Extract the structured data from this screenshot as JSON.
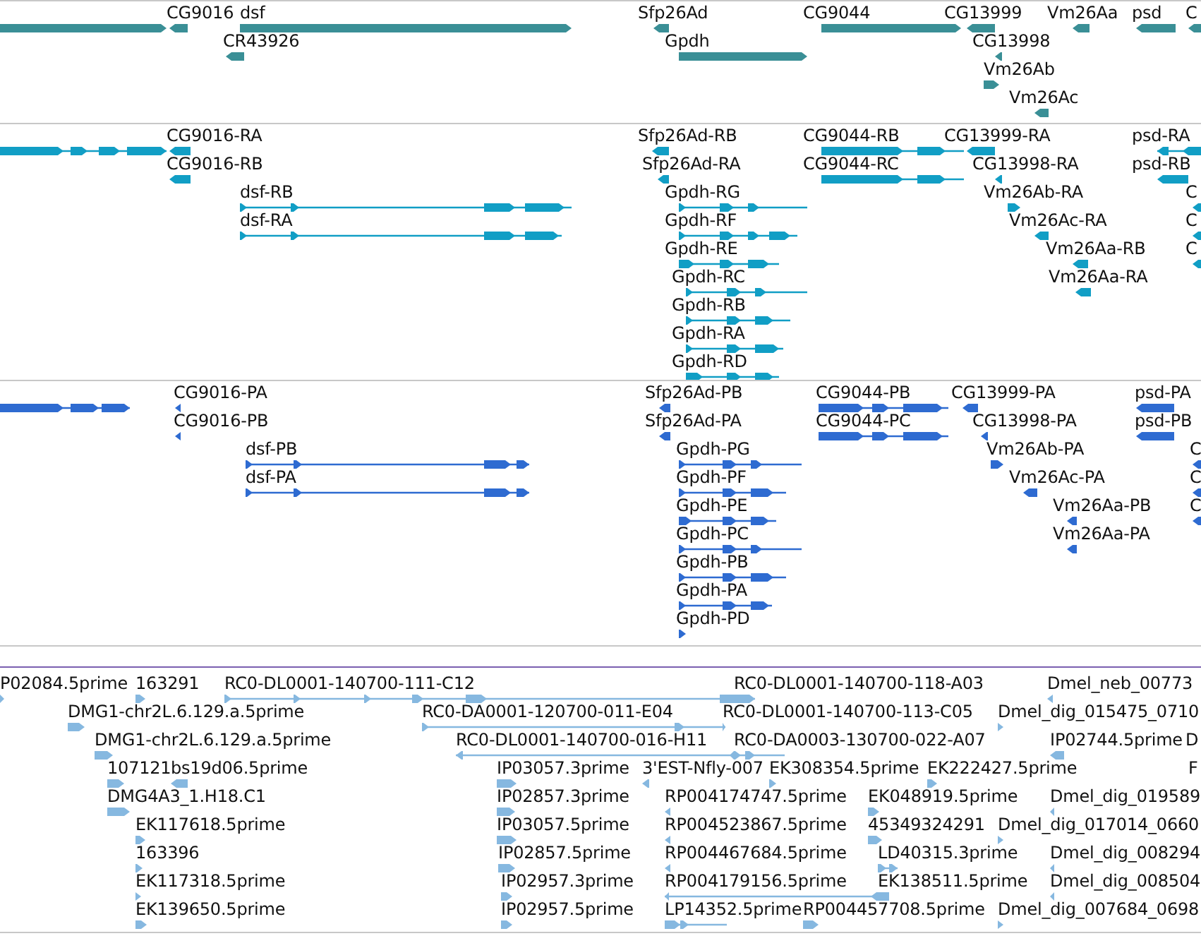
{
  "tracks": [
    {
      "color": "#3a8f96",
      "features": [
        {
          "label": "CG9016"
        },
        {
          "label": "dsf"
        },
        {
          "label": "CR43926"
        },
        {
          "label": "Sfp26Ad"
        },
        {
          "label": "Gpdh"
        },
        {
          "label": "CG9044"
        },
        {
          "label": "CG13999"
        },
        {
          "label": "CG13998"
        },
        {
          "label": "Vm26Ab"
        },
        {
          "label": "Vm26Ac"
        },
        {
          "label": "Vm26Aa"
        },
        {
          "label": "psd"
        },
        {
          "label": "C"
        }
      ]
    },
    {
      "color": "#119ec5",
      "features": [
        {
          "label": "CG9016-RA"
        },
        {
          "label": "CG9016-RB"
        },
        {
          "label": "dsf-RB"
        },
        {
          "label": "dsf-RA"
        },
        {
          "label": "Sfp26Ad-RB"
        },
        {
          "label": "Sfp26Ad-RA"
        },
        {
          "label": "Gpdh-RG"
        },
        {
          "label": "Gpdh-RF"
        },
        {
          "label": "Gpdh-RE"
        },
        {
          "label": "Gpdh-RC"
        },
        {
          "label": "Gpdh-RB"
        },
        {
          "label": "Gpdh-RA"
        },
        {
          "label": "Gpdh-RD"
        },
        {
          "label": "CG9044-RB"
        },
        {
          "label": "CG9044-RC"
        },
        {
          "label": "CG13999-RA"
        },
        {
          "label": "CG13998-RA"
        },
        {
          "label": "Vm26Ab-RA"
        },
        {
          "label": "Vm26Ac-RA"
        },
        {
          "label": "Vm26Aa-RB"
        },
        {
          "label": "Vm26Aa-RA"
        },
        {
          "label": "psd-RA"
        },
        {
          "label": "psd-RB"
        },
        {
          "label": "C"
        },
        {
          "label": "C"
        },
        {
          "label": "C"
        }
      ]
    },
    {
      "color": "#2e6bd1",
      "features": [
        {
          "label": "CG9016-PA"
        },
        {
          "label": "CG9016-PB"
        },
        {
          "label": "dsf-PB"
        },
        {
          "label": "dsf-PA"
        },
        {
          "label": "Sfp26Ad-PB"
        },
        {
          "label": "Sfp26Ad-PA"
        },
        {
          "label": "Gpdh-PG"
        },
        {
          "label": "Gpdh-PF"
        },
        {
          "label": "Gpdh-PE"
        },
        {
          "label": "Gpdh-PC"
        },
        {
          "label": "Gpdh-PB"
        },
        {
          "label": "Gpdh-PA"
        },
        {
          "label": "Gpdh-PD"
        },
        {
          "label": "CG9044-PB"
        },
        {
          "label": "CG9044-PC"
        },
        {
          "label": "CG13999-PA"
        },
        {
          "label": "CG13998-PA"
        },
        {
          "label": "Vm26Ab-PA"
        },
        {
          "label": "Vm26Ac-PA"
        },
        {
          "label": "Vm26Aa-PB"
        },
        {
          "label": "Vm26Aa-PA"
        },
        {
          "label": "psd-PA"
        },
        {
          "label": "psd-PB"
        },
        {
          "label": "C"
        },
        {
          "label": "C"
        },
        {
          "label": "C"
        }
      ]
    },
    {
      "color": "#86b8e0",
      "features": [
        {
          "label": "P02084.5prime"
        },
        {
          "label": "163291"
        },
        {
          "label": "RC0-DL0001-140700-111-C12"
        },
        {
          "label": "RC0-DL0001-140700-118-A03"
        },
        {
          "label": "Dmel_neb_00773"
        },
        {
          "label": "DMG1-chr2L.6.129.a.5prime"
        },
        {
          "label": "RC0-DA0001-120700-011-E04"
        },
        {
          "label": "RC0-DL0001-140700-113-C05"
        },
        {
          "label": "Dmel_dig_015475_0710"
        },
        {
          "label": "DMG1-chr2L.6.129.a.5prime"
        },
        {
          "label": "RC0-DL0001-140700-016-H11"
        },
        {
          "label": "RC0-DA0003-130700-022-A07"
        },
        {
          "label": "IP02744.5prime"
        },
        {
          "label": "D"
        },
        {
          "label": "107121"
        },
        {
          "label": "bs19d06.5prime"
        },
        {
          "label": "IP03057.3prime"
        },
        {
          "label": "3'EST-Nfly-007"
        },
        {
          "label": "EK308354.5prime"
        },
        {
          "label": "EK222427.5prime"
        },
        {
          "label": "F"
        },
        {
          "label": "DMG4A3_1.H18.C1"
        },
        {
          "label": "IP02857.3prime"
        },
        {
          "label": "RP004174747.5prime"
        },
        {
          "label": "EK048919.5prime"
        },
        {
          "label": "Dmel_dig_019589"
        },
        {
          "label": "EK117618.5prime"
        },
        {
          "label": "IP03057.5prime"
        },
        {
          "label": "RP004523867.5prime"
        },
        {
          "label": "45349324291"
        },
        {
          "label": "Dmel_dig_017014_0660"
        },
        {
          "label": "163396"
        },
        {
          "label": "IP02857.5prime"
        },
        {
          "label": "RP004467684.5prime"
        },
        {
          "label": "LD40315.3prime"
        },
        {
          "label": "Dmel_dig_008294"
        },
        {
          "label": "EK117318.5prime"
        },
        {
          "label": "IP02957.3prime"
        },
        {
          "label": "RP004179156.5prime"
        },
        {
          "label": "EK138511.5prime"
        },
        {
          "label": "Dmel_dig_008504"
        },
        {
          "label": "EK139650.5prime"
        },
        {
          "label": "IP02957.5prime"
        },
        {
          "label": "LP14352.5prime"
        },
        {
          "label": "RP004457708.5prime"
        },
        {
          "label": "Dmel_dig_007684_0698"
        }
      ]
    }
  ]
}
